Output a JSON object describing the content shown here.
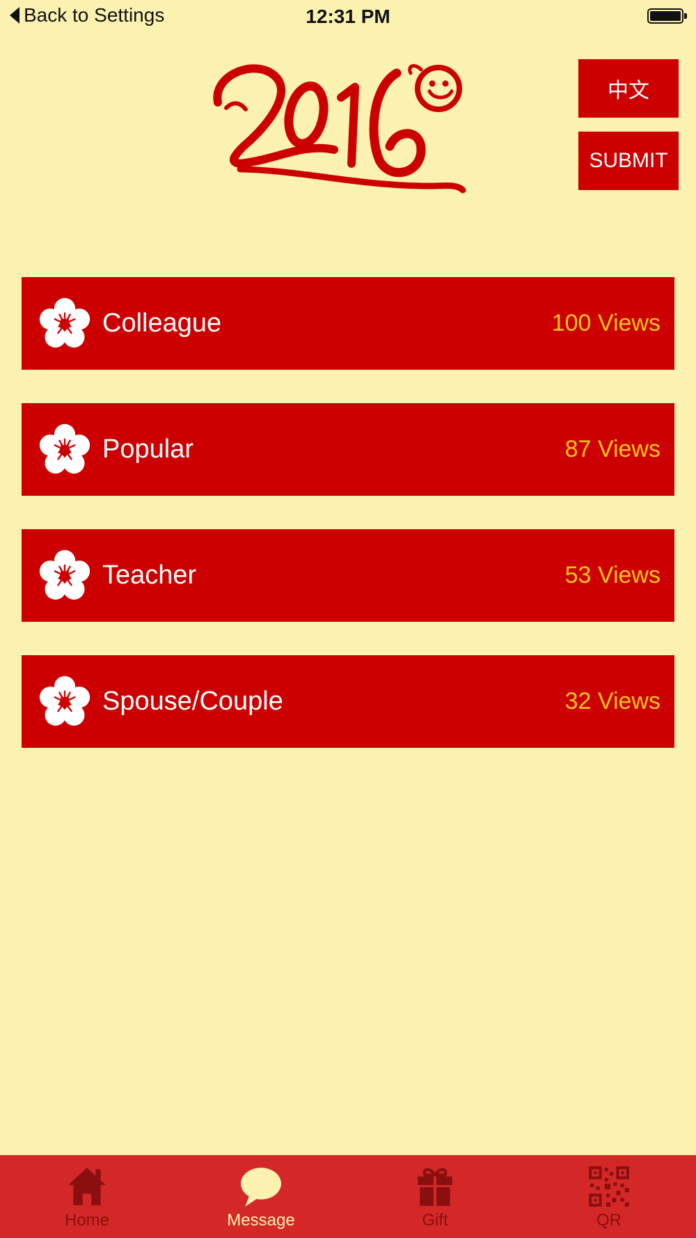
{
  "status_bar": {
    "back_label": "Back to Settings",
    "time": "12:31 PM"
  },
  "header": {
    "logo_text": "2016",
    "language_button": "中文",
    "submit_button": "SUBMIT"
  },
  "categories": [
    {
      "label": "Colleague",
      "views": "100 Views"
    },
    {
      "label": "Popular",
      "views": "87 Views"
    },
    {
      "label": "Teacher",
      "views": "53 Views"
    },
    {
      "label": "Spouse/Couple",
      "views": "32 Views"
    }
  ],
  "tabs": [
    {
      "label": "Home",
      "icon": "home-icon",
      "active": false
    },
    {
      "label": "Message",
      "icon": "message-icon",
      "active": true
    },
    {
      "label": "Gift",
      "icon": "gift-icon",
      "active": false
    },
    {
      "label": "QR",
      "icon": "qr-icon",
      "active": false
    }
  ],
  "colors": {
    "background": "#fcf2b0",
    "accent_red": "#cc0000",
    "views_yellow": "#f5c518",
    "tab_bar": "#d42828"
  }
}
